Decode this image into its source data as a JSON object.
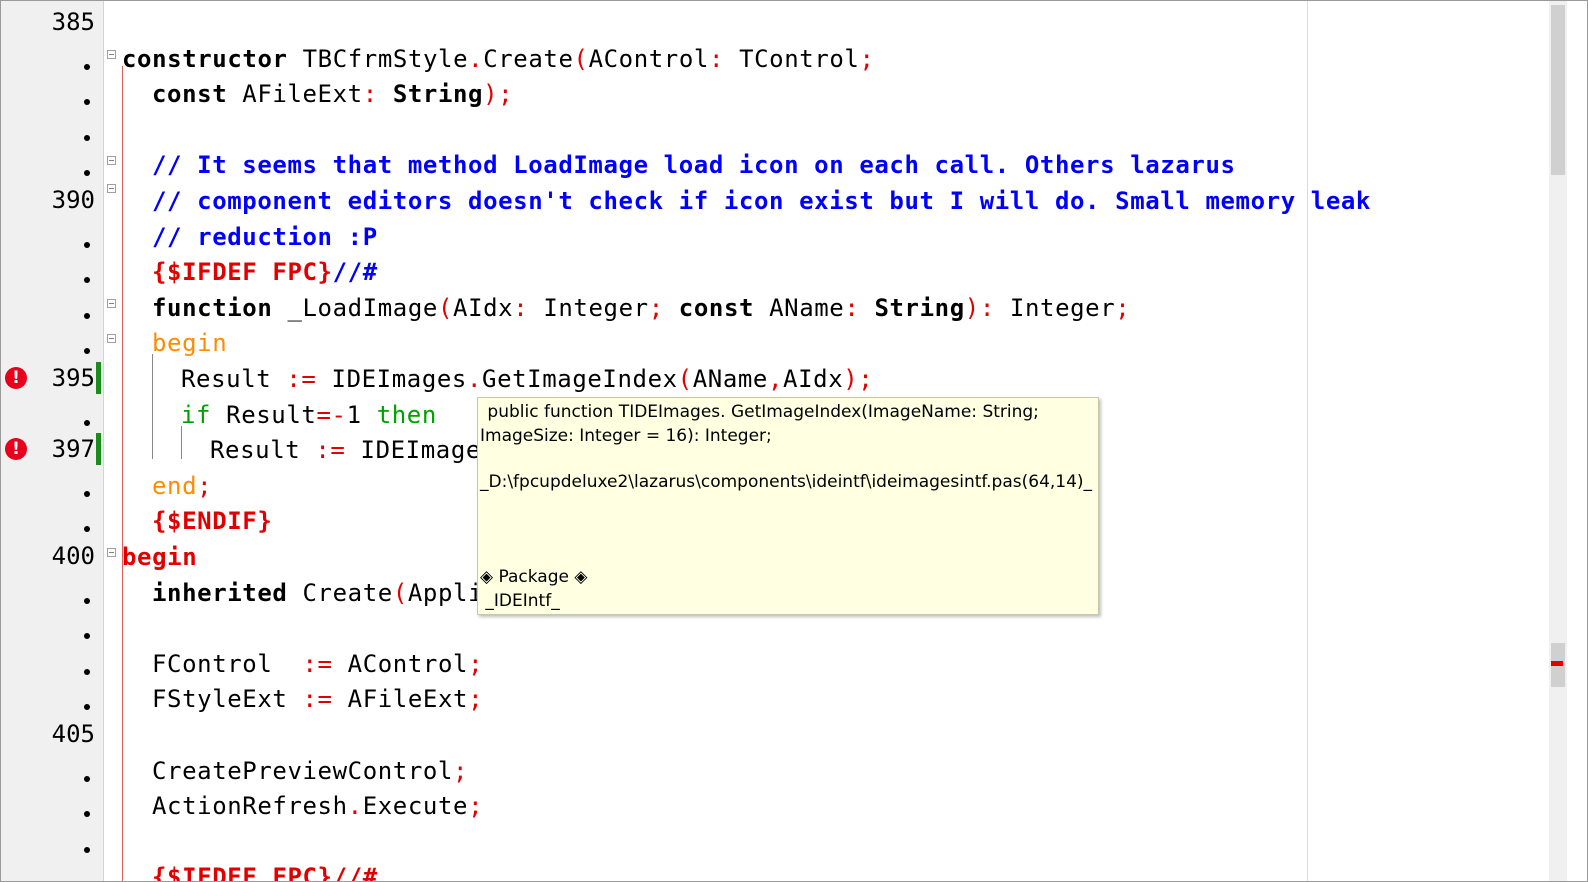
{
  "gutter": {
    "line_numbers": [
      "385",
      "390",
      "395",
      "397",
      "400",
      "405"
    ],
    "error_glyph": "!"
  },
  "code": {
    "l385": "",
    "l386": [
      {
        "t": "constructor",
        "c": "kw"
      },
      {
        "t": " TBCfrmStyle",
        "c": "id"
      },
      {
        "t": ".",
        "c": "sym"
      },
      {
        "t": "Create",
        "c": "id"
      },
      {
        "t": "(",
        "c": "sym"
      },
      {
        "t": "AControl",
        "c": "id"
      },
      {
        "t": ":",
        "c": "sym"
      },
      {
        "t": " TControl",
        "c": "id"
      },
      {
        "t": ";",
        "c": "sym"
      }
    ],
    "l387": [
      {
        "t": "const",
        "c": "kw"
      },
      {
        "t": " AFileExt",
        "c": "id"
      },
      {
        "t": ":",
        "c": "sym"
      },
      {
        "t": " String",
        "c": "kw"
      },
      {
        "t": ");",
        "c": "sym"
      }
    ],
    "l389": [
      {
        "t": "// It seems that method LoadImage load icon on each call. Others lazarus",
        "c": "cm"
      }
    ],
    "l390": [
      {
        "t": "// component editors doesn't check if icon exist but I will do. Small memory leak",
        "c": "cm"
      }
    ],
    "l391": [
      {
        "t": "// reduction :P",
        "c": "cm"
      }
    ],
    "l392": [
      {
        "t": "{$IFDEF FPC}",
        "c": "dir"
      },
      {
        "t": "//#",
        "c": "cm"
      }
    ],
    "l393": [
      {
        "t": "function",
        "c": "kw"
      },
      {
        "t": " _LoadImage",
        "c": "id"
      },
      {
        "t": "(",
        "c": "sym"
      },
      {
        "t": "AIdx",
        "c": "id"
      },
      {
        "t": ":",
        "c": "sym"
      },
      {
        "t": " Integer",
        "c": "id"
      },
      {
        "t": ";",
        "c": "sym"
      },
      {
        "t": " const",
        "c": "kw"
      },
      {
        "t": " AName",
        "c": "id"
      },
      {
        "t": ":",
        "c": "sym"
      },
      {
        "t": " String",
        "c": "kw"
      },
      {
        "t": "):",
        "c": "sym"
      },
      {
        "t": " Integer",
        "c": "id"
      },
      {
        "t": ";",
        "c": "sym"
      }
    ],
    "l394": [
      {
        "t": "begin",
        "c": "blkw"
      }
    ],
    "l395": [
      {
        "t": "Result ",
        "c": "id"
      },
      {
        "t": ":=",
        "c": "sym"
      },
      {
        "t": " IDEImages",
        "c": "id"
      },
      {
        "t": ".",
        "c": "sym"
      },
      {
        "t": "GetImageIndex",
        "c": "id"
      },
      {
        "t": "(",
        "c": "sym"
      },
      {
        "t": "AName",
        "c": "id"
      },
      {
        "t": ",",
        "c": "sym"
      },
      {
        "t": "AIdx",
        "c": "id"
      },
      {
        "t": ");",
        "c": "sym"
      }
    ],
    "l396": [
      {
        "t": "if",
        "c": "grn"
      },
      {
        "t": " Result",
        "c": "id"
      },
      {
        "t": "=-",
        "c": "sym"
      },
      {
        "t": "1",
        "c": "num"
      },
      {
        "t": " then",
        "c": "grn"
      }
    ],
    "l397": [
      {
        "t": "Result ",
        "c": "id"
      },
      {
        "t": ":=",
        "c": "sym"
      },
      {
        "t": " IDEImage",
        "c": "id"
      }
    ],
    "l398": [
      {
        "t": "end",
        "c": "blkw"
      },
      {
        "t": ";",
        "c": "sym"
      }
    ],
    "l399": [
      {
        "t": "{$ENDIF}",
        "c": "dir"
      }
    ],
    "l400": [
      {
        "t": "begin",
        "c": "dir"
      }
    ],
    "l401": [
      {
        "t": "inherited",
        "c": "kw"
      },
      {
        "t": " Create",
        "c": "id"
      },
      {
        "t": "(",
        "c": "sym"
      },
      {
        "t": "Appli",
        "c": "id"
      }
    ],
    "l403": [
      {
        "t": "FControl  ",
        "c": "id"
      },
      {
        "t": ":=",
        "c": "sym"
      },
      {
        "t": " AControl",
        "c": "id"
      },
      {
        "t": ";",
        "c": "sym"
      }
    ],
    "l404": [
      {
        "t": "FStyleExt ",
        "c": "id"
      },
      {
        "t": ":=",
        "c": "sym"
      },
      {
        "t": " AFileExt",
        "c": "id"
      },
      {
        "t": ";",
        "c": "sym"
      }
    ],
    "l406": [
      {
        "t": "CreatePreviewControl",
        "c": "id"
      },
      {
        "t": ";",
        "c": "sym"
      }
    ],
    "l407": [
      {
        "t": "ActionRefresh",
        "c": "id"
      },
      {
        "t": ".",
        "c": "sym"
      },
      {
        "t": "Execute",
        "c": "id"
      },
      {
        "t": ";",
        "c": "sym"
      }
    ],
    "l409": [
      {
        "t": "{$IFDEF FPC}//#",
        "c": "dir"
      }
    ]
  },
  "hint": {
    "line1": " public function TIDEImages. GetImageIndex(ImageName: String;",
    "line2": "ImageSize: Integer = 16): Integer;",
    "path": "_D:\\fpcupdeluxe2\\lazarus\\components\\ideintf\\ideimagesintf.pas(64,14)_",
    "package_label": "◈ Package ◈",
    "package_name": " _IDEIntf_"
  },
  "colors": {
    "keyword": "#000000",
    "symbol": "#e00000",
    "comment": "#0000ff",
    "directive": "#e00000",
    "block_keyword": "#ff8c00",
    "green_keyword": "#00a000",
    "hint_bg": "#ffffe1",
    "error": "#e8001c",
    "modified": "#1a8c1a"
  }
}
